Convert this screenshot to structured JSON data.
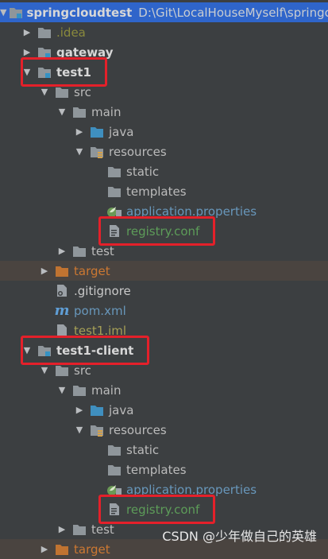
{
  "project": {
    "name": "springcloudtest",
    "path": "D:\\Git\\LocalHouseMyself\\springc"
  },
  "tree": [
    {
      "label": "springcloudtest",
      "depth": 0,
      "arrow": "down",
      "icon": "module-folder-icon",
      "style": "bold",
      "path": "D:\\Git\\LocalHouseMyself\\springc",
      "selected": true
    },
    {
      "label": ".idea",
      "depth": 1,
      "arrow": "right",
      "icon": "folder-icon",
      "style": "idea"
    },
    {
      "label": "gateway",
      "depth": 1,
      "arrow": "right",
      "icon": "module-folder-icon",
      "style": "bold"
    },
    {
      "label": "test1",
      "depth": 1,
      "arrow": "down",
      "icon": "module-folder-icon",
      "style": "bold",
      "highlight": "true"
    },
    {
      "label": "src",
      "depth": 2,
      "arrow": "down",
      "icon": "folder-icon",
      "style": "normal"
    },
    {
      "label": "main",
      "depth": 3,
      "arrow": "down",
      "icon": "folder-icon",
      "style": "normal"
    },
    {
      "label": "java",
      "depth": 4,
      "arrow": "right",
      "icon": "source-folder-icon",
      "style": "normal"
    },
    {
      "label": "resources",
      "depth": 4,
      "arrow": "down",
      "icon": "resources-folder-icon",
      "style": "normal"
    },
    {
      "label": "static",
      "depth": 5,
      "arrow": "none",
      "icon": "folder-icon",
      "style": "normal"
    },
    {
      "label": "templates",
      "depth": 5,
      "arrow": "none",
      "icon": "folder-icon",
      "style": "normal"
    },
    {
      "label": "application.properties",
      "depth": 5,
      "arrow": "none",
      "icon": "spring-properties-icon",
      "style": "blue"
    },
    {
      "label": "registry.conf",
      "depth": 5,
      "arrow": "none",
      "icon": "text-file-icon",
      "style": "green",
      "highlight": "true"
    },
    {
      "label": "test",
      "depth": 3,
      "arrow": "right",
      "icon": "folder-icon",
      "style": "normal"
    },
    {
      "label": "target",
      "depth": 2,
      "arrow": "right",
      "icon": "excluded-folder-icon",
      "style": "orange",
      "excluded": true
    },
    {
      "label": ".gitignore",
      "depth": 2,
      "arrow": "none",
      "icon": "gitignore-file-icon",
      "style": "git"
    },
    {
      "label": "pom.xml",
      "depth": 2,
      "arrow": "none",
      "icon": "maven-icon",
      "style": "blue"
    },
    {
      "label": "test1.iml",
      "depth": 2,
      "arrow": "none",
      "icon": "iml-file-icon",
      "style": "yellow"
    },
    {
      "label": "test1-client",
      "depth": 1,
      "arrow": "down",
      "icon": "module-folder-icon",
      "style": "bold",
      "highlight": "true"
    },
    {
      "label": "src",
      "depth": 2,
      "arrow": "down",
      "icon": "folder-icon",
      "style": "normal"
    },
    {
      "label": "main",
      "depth": 3,
      "arrow": "down",
      "icon": "folder-icon",
      "style": "normal"
    },
    {
      "label": "java",
      "depth": 4,
      "arrow": "right",
      "icon": "source-folder-icon",
      "style": "normal"
    },
    {
      "label": "resources",
      "depth": 4,
      "arrow": "down",
      "icon": "resources-folder-icon",
      "style": "normal"
    },
    {
      "label": "static",
      "depth": 5,
      "arrow": "none",
      "icon": "folder-icon",
      "style": "normal"
    },
    {
      "label": "templates",
      "depth": 5,
      "arrow": "none",
      "icon": "folder-icon",
      "style": "normal"
    },
    {
      "label": "application.properties",
      "depth": 5,
      "arrow": "none",
      "icon": "spring-properties-icon",
      "style": "blue"
    },
    {
      "label": "registry.conf",
      "depth": 5,
      "arrow": "none",
      "icon": "text-file-icon",
      "style": "green",
      "highlight": "true"
    },
    {
      "label": "test",
      "depth": 3,
      "arrow": "right",
      "icon": "folder-icon",
      "style": "normal"
    },
    {
      "label": "target",
      "depth": 2,
      "arrow": "right",
      "icon": "excluded-folder-icon",
      "style": "orange",
      "excluded": true
    }
  ],
  "watermark": "CSDN @少年做自己的英雄",
  "colors": {
    "background": "#3c3f41",
    "selection": "#2f65ca",
    "highlight_box": "#e4202a",
    "folder": "#8f969b",
    "excluded_folder": "#c07331"
  }
}
